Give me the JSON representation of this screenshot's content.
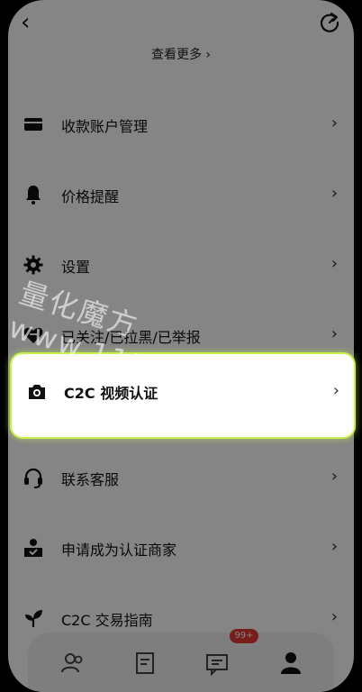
{
  "header": {
    "more_link": "查看更多 ›"
  },
  "menu": [
    {
      "label": "收款账户管理",
      "icon": "card-icon"
    },
    {
      "label": "价格提醒",
      "icon": "bell-icon"
    },
    {
      "label": "设置",
      "icon": "gear-icon"
    },
    {
      "label": "已关注/已拉黑/已举报",
      "icon": "heart-icon"
    },
    {
      "label": "C2C 视频认证",
      "icon": "camera-icon"
    },
    {
      "label": "联系客服",
      "icon": "headset-icon"
    },
    {
      "label": "申请成为认证商家",
      "icon": "merchant-icon"
    },
    {
      "label": "C2C 交易指南",
      "icon": "sprout-icon"
    }
  ],
  "chevron": "›",
  "tabbar": {
    "badge": "99+"
  },
  "watermark": "量化魔方www.115KU.com",
  "colors": {
    "highlight_border": "#c8f04a",
    "badge": "#e53935"
  }
}
